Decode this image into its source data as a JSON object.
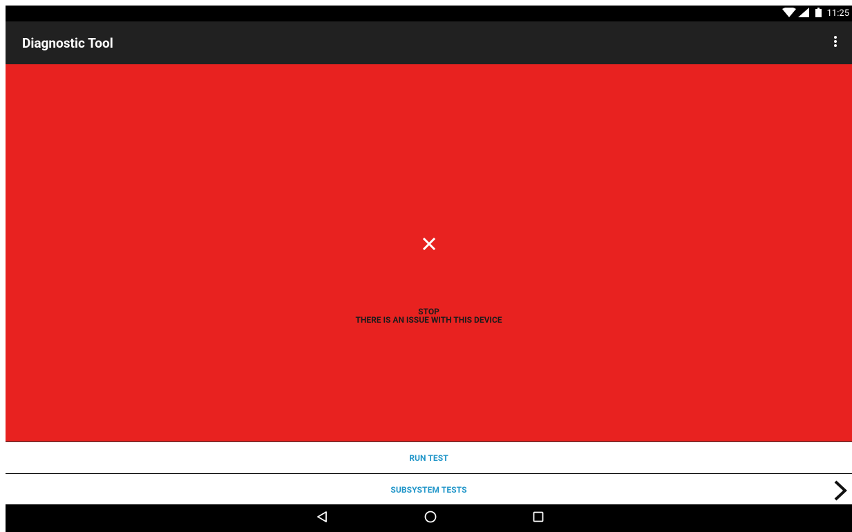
{
  "status_bar": {
    "time": "11:25",
    "icons": [
      "wifi-icon",
      "cellular-signal-icon",
      "battery-icon"
    ]
  },
  "app_bar": {
    "title": "Diagnostic Tool",
    "overflow_icon": "more-vert-icon"
  },
  "result_panel": {
    "background_color": "#e82220",
    "icon": "close-x-icon",
    "message_line1": "STOP",
    "message_line2": "THERE IS AN ISSUE WITH THIS DEVICE"
  },
  "actions": {
    "run_test_label": "RUN TEST",
    "subsystem_tests_label": "SUBSYSTEM TESTS",
    "subsystem_chevron_icon": "chevron-right-icon",
    "accent_color": "#2196c9"
  },
  "nav_bar": {
    "buttons": [
      "back-icon",
      "home-icon",
      "recents-icon"
    ]
  }
}
